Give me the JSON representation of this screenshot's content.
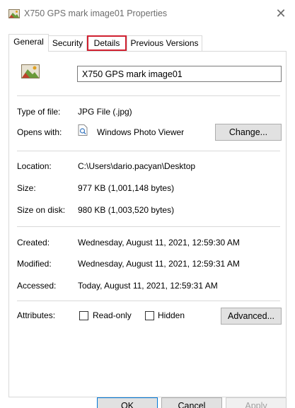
{
  "window": {
    "title": "X750 GPS mark image01 Properties",
    "close_glyph": "✕",
    "title_icon": "image-file-icon"
  },
  "tabs": [
    {
      "label": "General",
      "active": true
    },
    {
      "label": "Security",
      "active": false
    },
    {
      "label": "Details",
      "active": false,
      "highlighted": true
    },
    {
      "label": "Previous Versions",
      "active": false
    }
  ],
  "general": {
    "file_name": "X750 GPS mark image01",
    "type_of_file": {
      "label": "Type of file:",
      "value": "JPG File (.jpg)"
    },
    "opens_with": {
      "label": "Opens with:",
      "value": "Windows Photo Viewer",
      "button": "Change...",
      "icon": "photo-viewer-icon"
    },
    "location": {
      "label": "Location:",
      "value": "C:\\Users\\dario.pacyan\\Desktop"
    },
    "size": {
      "label": "Size:",
      "value": "977 KB (1,001,148 bytes)"
    },
    "size_on_disk": {
      "label": "Size on disk:",
      "value": "980 KB (1,003,520 bytes)"
    },
    "created": {
      "label": "Created:",
      "value": "Wednesday, August 11, 2021, 12:59:30 AM"
    },
    "modified": {
      "label": "Modified:",
      "value": "Wednesday, August 11, 2021, 12:59:31 AM"
    },
    "accessed": {
      "label": "Accessed:",
      "value": "Today, August 11, 2021, 12:59:31 AM"
    },
    "attributes": {
      "label": "Attributes:",
      "read_only": {
        "label": "Read-only",
        "checked": false
      },
      "hidden": {
        "label": "Hidden",
        "checked": false
      },
      "advanced_button": "Advanced..."
    }
  },
  "footer": {
    "ok": "OK",
    "cancel": "Cancel",
    "apply": "Apply"
  },
  "colors": {
    "highlight_border": "#d02030",
    "ok_border": "#0078d7"
  }
}
